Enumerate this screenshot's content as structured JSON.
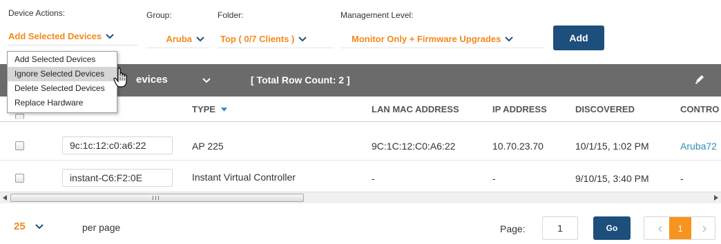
{
  "filters": {
    "device_actions_label": "Device Actions:",
    "device_actions_value": "Add Selected Devices",
    "group_label": "Group:",
    "group_value": "Aruba",
    "folder_label": "Folder:",
    "folder_value": "Top ( 0/7 Clients )",
    "management_label": "Management Level:",
    "management_value": "Monitor Only + Firmware Upgrades",
    "add_button": "Add"
  },
  "menu": {
    "items": [
      "Add Selected Devices",
      "Ignore Selected Devices",
      "Delete Selected Devices",
      "Replace Hardware"
    ],
    "highlighted_index": 1
  },
  "table_bar": {
    "title_fragment": "evices",
    "total_row_count": "[ Total Row Count: 2 ]"
  },
  "table": {
    "columns": [
      "TYPE",
      "LAN MAC ADDRESS",
      "IP ADDRESS",
      "DISCOVERED",
      "CONTRO"
    ],
    "rows": [
      {
        "name": "9c:1c:12:c0:a6:22",
        "type": "AP 225",
        "lan_mac": "9C:1C:12:C0:A6:22",
        "ip": "10.70.23.70",
        "discovered": "10/1/15, 1:02 PM",
        "controller": "Aruba72"
      },
      {
        "name": "instant-C6:F2:0E",
        "type": "Instant Virtual Controller",
        "lan_mac": "-",
        "ip": "-",
        "discovered": "9/10/15, 3:40 PM",
        "controller": "-"
      }
    ]
  },
  "pagination": {
    "per_page_value": "25",
    "per_page_label": "per page",
    "page_label": "Page:",
    "page_input": "1",
    "go_button": "Go",
    "current_page": "1"
  },
  "colors": {
    "accent": "#f08a1c",
    "primary": "#1d4f7c",
    "bar": "#6b6b6b",
    "link": "#2c8fb7"
  }
}
